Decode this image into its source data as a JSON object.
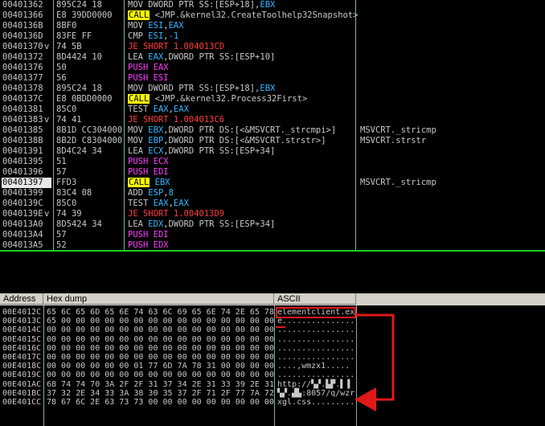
{
  "disasm": {
    "rows": [
      {
        "addr": "00401362",
        "jmp": "",
        "hex": "895C24 18",
        "mn": "MOV",
        "ops": [
          [
            "plain",
            "DWORD PTR SS:[ESP+18],"
          ],
          [
            "reg",
            "EBX"
          ]
        ],
        "comment": ""
      },
      {
        "addr": "00401366",
        "jmp": "",
        "hex": "E8 39DD0000",
        "mn": "CALL",
        "ops": [
          [
            "plain",
            " <JMP.&kernel32.CreateToolhelp32Snapshot>"
          ]
        ],
        "comment": ""
      },
      {
        "addr": "0040136B",
        "jmp": "",
        "hex": "8BF0",
        "mn": "MOV",
        "ops": [
          [
            "reg",
            "ESI"
          ],
          [
            "plain",
            ","
          ],
          [
            "reg",
            "EAX"
          ]
        ],
        "comment": ""
      },
      {
        "addr": "0040136D",
        "jmp": "",
        "hex": "83FE FF",
        "mn": "CMP",
        "ops": [
          [
            "reg",
            "ESI"
          ],
          [
            "plain",
            ","
          ],
          [
            "reg",
            "-1"
          ]
        ],
        "comment": ""
      },
      {
        "addr": "00401370",
        "jmp": "v",
        "hex": "74 5B",
        "mn": "JE",
        "ops": [
          [
            "plain",
            "SHORT 1.004013CD"
          ]
        ],
        "comment": ""
      },
      {
        "addr": "00401372",
        "jmp": "",
        "hex": "8D4424 10",
        "mn": "LEA",
        "ops": [
          [
            "reg",
            "EAX"
          ],
          [
            "plain",
            ",DWORD PTR SS:[ESP+10]"
          ]
        ],
        "comment": ""
      },
      {
        "addr": "00401376",
        "jmp": "",
        "hex": "50",
        "mn": "PUSH",
        "ops": [
          [
            "plain",
            "EAX"
          ]
        ],
        "comment": ""
      },
      {
        "addr": "00401377",
        "jmp": "",
        "hex": "56",
        "mn": "PUSH",
        "ops": [
          [
            "plain",
            "ESI"
          ]
        ],
        "comment": ""
      },
      {
        "addr": "00401378",
        "jmp": "",
        "hex": "895C24 18",
        "mn": "MOV",
        "ops": [
          [
            "plain",
            "DWORD PTR SS:[ESP+18],"
          ],
          [
            "reg",
            "EBX"
          ]
        ],
        "comment": ""
      },
      {
        "addr": "0040137C",
        "jmp": "",
        "hex": "E8 0BDD0000",
        "mn": "CALL",
        "ops": [
          [
            "plain",
            " <JMP.&kernel32.Process32First>"
          ]
        ],
        "comment": ""
      },
      {
        "addr": "00401381",
        "jmp": "",
        "hex": "85C0",
        "mn": "TEST",
        "ops": [
          [
            "reg",
            "EAX"
          ],
          [
            "plain",
            ","
          ],
          [
            "reg",
            "EAX"
          ]
        ],
        "comment": ""
      },
      {
        "addr": "00401383",
        "jmp": "v",
        "hex": "74 41",
        "mn": "JE",
        "ops": [
          [
            "plain",
            "SHORT 1.004013C6"
          ]
        ],
        "comment": ""
      },
      {
        "addr": "00401385",
        "jmp": "",
        "hex": "8B1D CC304000",
        "mn": "MOV",
        "ops": [
          [
            "reg",
            "EBX"
          ],
          [
            "plain",
            ",DWORD PTR DS:[<&MSVCRT._strcmpi>]"
          ]
        ],
        "comment": "MSVCRT._stricmp"
      },
      {
        "addr": "0040138B",
        "jmp": "",
        "hex": "8B2D C8304000",
        "mn": "MOV",
        "ops": [
          [
            "reg",
            "EBP"
          ],
          [
            "plain",
            ",DWORD PTR DS:[<&MSVCRT.strstr>]"
          ]
        ],
        "comment": "MSVCRT.strstr"
      },
      {
        "addr": "00401391",
        "jmp": "",
        "hex": "8D4C24 34",
        "mn": "LEA",
        "ops": [
          [
            "reg",
            "ECX"
          ],
          [
            "plain",
            ",DWORD PTR SS:[ESP+34]"
          ]
        ],
        "comment": ""
      },
      {
        "addr": "00401395",
        "jmp": "",
        "hex": "51",
        "mn": "PUSH",
        "ops": [
          [
            "plain",
            "ECX"
          ]
        ],
        "comment": ""
      },
      {
        "addr": "00401396",
        "jmp": "",
        "hex": "57",
        "mn": "PUSH",
        "ops": [
          [
            "plain",
            "EDI"
          ]
        ],
        "comment": ""
      },
      {
        "addr": "00401397",
        "jmp": "",
        "hex": "FFD3",
        "mn": "CALL",
        "ops": [
          [
            "reg",
            " EBX"
          ]
        ],
        "comment": "MSVCRT._stricmp",
        "selected": true
      },
      {
        "addr": "00401399",
        "jmp": "",
        "hex": "83C4 08",
        "mn": "ADD",
        "ops": [
          [
            "reg",
            "ESP"
          ],
          [
            "plain",
            ","
          ],
          [
            "reg",
            "8"
          ]
        ],
        "comment": ""
      },
      {
        "addr": "0040139C",
        "jmp": "",
        "hex": "85C0",
        "mn": "TEST",
        "ops": [
          [
            "reg",
            "EAX"
          ],
          [
            "plain",
            ","
          ],
          [
            "reg",
            "EAX"
          ]
        ],
        "comment": ""
      },
      {
        "addr": "0040139E",
        "jmp": "v",
        "hex": "74 39",
        "mn": "JE",
        "ops": [
          [
            "plain",
            "SHORT 1.004013D9"
          ]
        ],
        "comment": ""
      },
      {
        "addr": "004013A0",
        "jmp": "",
        "hex": "8D5424 34",
        "mn": "LEA",
        "ops": [
          [
            "reg",
            "EDX"
          ],
          [
            "plain",
            ",DWORD PTR SS:[ESP+34]"
          ]
        ],
        "comment": ""
      },
      {
        "addr": "004013A4",
        "jmp": "",
        "hex": "57",
        "mn": "PUSH",
        "ops": [
          [
            "plain",
            "EDI"
          ]
        ],
        "comment": ""
      },
      {
        "addr": "004013A5",
        "jmp": "",
        "hex": "52",
        "mn": "PUSH",
        "ops": [
          [
            "plain",
            "EDX"
          ]
        ],
        "comment": ""
      }
    ]
  },
  "dump": {
    "header": {
      "address": "Address",
      "hex": "Hex dump",
      "ascii": "ASCII"
    },
    "rows": [
      {
        "addr": "00E4012C",
        "hex": "65 6C 65 6D 65 6E 74 63 6C 69 65 6E 74 2E 65 78",
        "ascii": "elementclient.ex"
      },
      {
        "addr": "00E4013C",
        "hex": "65 00 00 00 00 00 00 00 00 00 00 00 00 00 00 00",
        "ascii": "e..............."
      },
      {
        "addr": "00E4014C",
        "hex": "00 00 00 00 00 00 00 00 00 00 00 00 00 00 00 00",
        "ascii": "................"
      },
      {
        "addr": "00E4015C",
        "hex": "00 00 00 00 00 00 00 00 00 00 00 00 00 00 00 00",
        "ascii": "................"
      },
      {
        "addr": "00E4016C",
        "hex": "00 00 00 00 00 00 00 00 00 00 00 00 00 00 00 00",
        "ascii": "................"
      },
      {
        "addr": "00E4017C",
        "hex": "00 00 00 00 00 00 00 00 00 00 00 00 00 00 00 00",
        "ascii": "................"
      },
      {
        "addr": "00E4018C",
        "hex": "00 00 00 00 00 00 01 77 6D 7A 78 31 00 00 00 00",
        "ascii": "....,wmzx1....."
      },
      {
        "addr": "00E4019C",
        "hex": "00 00 00 00 00 00 00 00 00 00 00 00 00 00 00 00",
        "ascii": "................"
      },
      {
        "addr": "00E401AC",
        "hex": "68 74 74 70 3A 2F 2F 31 37 34 2E 31 33 39 2E 31",
        "ascii": "http://▚▞.▙▛.▌▐"
      },
      {
        "addr": "00E401BC",
        "hex": "37 32 2E 34 33 3A 38 30 35 37 2F 71 2F 77 7A 72",
        "ascii": "▚▞.▟▙:8057/q/wzr"
      },
      {
        "addr": "00E401CC",
        "hex": "78 67 6C 2E 63 73 73 00 00 00 00 00 00 00 00 00",
        "ascii": "xgl.css........."
      }
    ]
  }
}
